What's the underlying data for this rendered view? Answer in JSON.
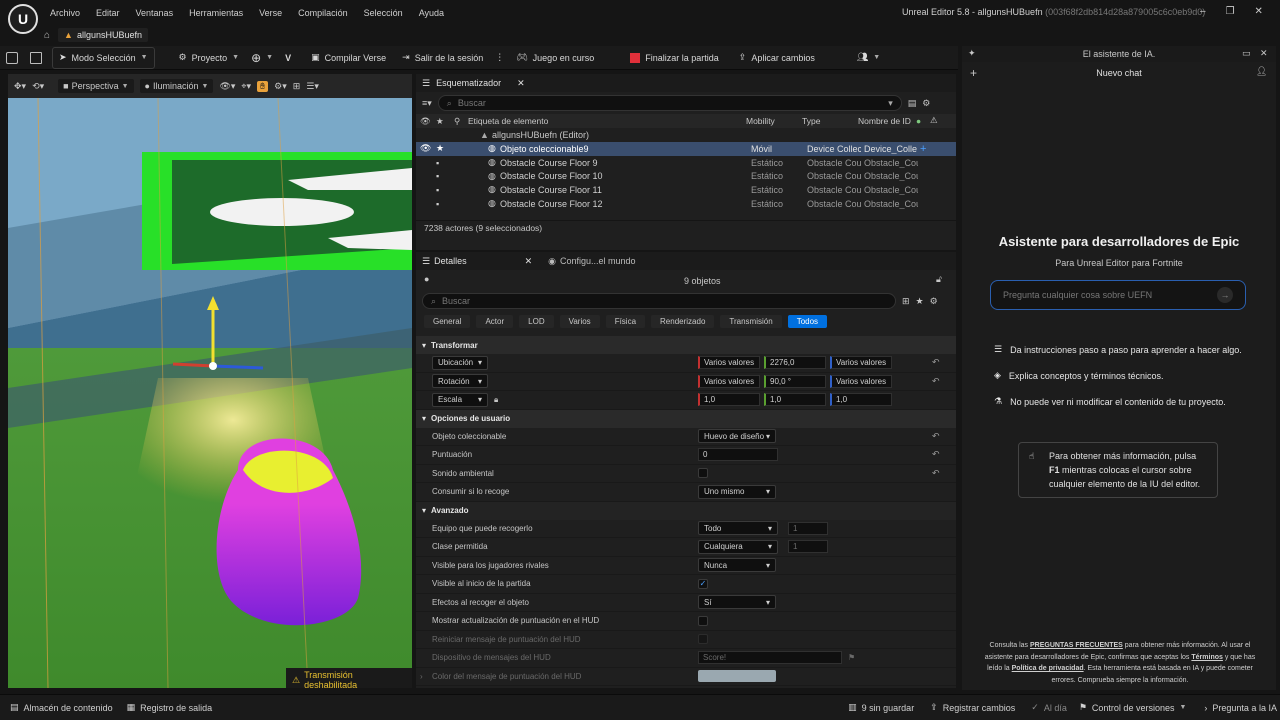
{
  "menu": [
    "Archivo",
    "Editar",
    "Ventanas",
    "Herramientas",
    "Verse",
    "Compilación",
    "Selección",
    "Ayuda"
  ],
  "window_title": "Unreal Editor 5.8 - allgunsHUBuefn",
  "window_id": "(003f68f2db814d28a879005c6c0eb9d0)",
  "project_tab": "allgunsHUBuefn",
  "toolbar": {
    "mode": "Modo Selección",
    "project": "Proyecto",
    "compile_verse": "Compilar Verse",
    "leave_session": "Salir de la sesión",
    "game_in_progress": "Juego en curso",
    "end_game": "Finalizar la partida",
    "apply_changes": "Aplicar cambios"
  },
  "viewport": {
    "perspective": "Perspectiva",
    "lighting": "Iluminación",
    "transmission_disabled": "Transmisión deshabilitada"
  },
  "outliner": {
    "tab_title": "Esquematizador",
    "search_placeholder": "Buscar",
    "columns": {
      "label": "Etiqueta de elemento",
      "mobility": "Mobility",
      "type": "Type",
      "id_name": "Nombre de ID"
    },
    "root": "allgunsHUBuefn (Editor)",
    "rows": [
      {
        "label": "Objeto coleccionable9",
        "mobility": "Móvil",
        "type": "Device Collec",
        "id": "Device_Colle",
        "selected": true
      },
      {
        "label": "Obstacle Course Floor 9",
        "mobility": "Estático",
        "type": "Obstacle Cou",
        "id": "Obstacle_Cou",
        "selected": false
      },
      {
        "label": "Obstacle Course Floor 10",
        "mobility": "Estático",
        "type": "Obstacle Cou",
        "id": "Obstacle_Cou",
        "selected": false
      },
      {
        "label": "Obstacle Course Floor 11",
        "mobility": "Estático",
        "type": "Obstacle Cou",
        "id": "Obstacle_Cou",
        "selected": false
      },
      {
        "label": "Obstacle Course Floor 12",
        "mobility": "Estático",
        "type": "Obstacle Cou",
        "id": "Obstacle_Cou",
        "selected": false
      }
    ],
    "actor_count": "7238 actores (9 seleccionados)"
  },
  "details": {
    "tab_title": "Detalles",
    "world_tab": "Configu...el mundo",
    "objects": "9 objetos",
    "search_placeholder": "Buscar",
    "categories": [
      "General",
      "Actor",
      "LOD",
      "Varios",
      "Física",
      "Renderizado",
      "Transmisión",
      "Todos"
    ],
    "transform": {
      "header": "Transformar",
      "location": "Ubicación",
      "rotation": "Rotación",
      "scale": "Escala",
      "loc_values": [
        "Varios valores",
        "2276,0",
        "Varios valores"
      ],
      "rot_values": [
        "Varios valores",
        "90,0 °",
        "Varios valores"
      ],
      "scale_values": [
        "1,0",
        "1,0",
        "1,0"
      ]
    },
    "user_options": {
      "header": "Opciones de usuario",
      "collectible": "Objeto coleccionable",
      "collectible_val": "Huevo de diseño",
      "score": "Puntuación",
      "score_val": "0",
      "ambient_sound": "Sonido ambiental",
      "consume": "Consumir si lo recoge",
      "consume_val": "Uno mismo"
    },
    "advanced": {
      "header": "Avanzado",
      "team": "Equipo que puede recogerlo",
      "team_val": "Todo",
      "team_num": "1",
      "class": "Clase permitida",
      "class_val": "Cualquiera",
      "class_num": "1",
      "visible_rivals": "Visible para los jugadores rivales",
      "visible_rivals_val": "Nunca",
      "visible_start": "Visible al inicio de la partida",
      "pickup_effects": "Efectos al recoger el objeto",
      "pickup_effects_val": "Sí",
      "show_hud": "Mostrar actualización de puntuación en el HUD",
      "restart_msg": "Reiniciar mensaje de puntuación del HUD",
      "hud_device": "Dispositivo de mensajes del HUD",
      "hud_device_val": "Score!",
      "hud_color": "Color del mensaje de puntuación del HUD"
    }
  },
  "ai": {
    "header": "El asistente de IA.",
    "new_chat": "Nuevo chat",
    "title": "Asistente para desarrolladores de Epic",
    "subtitle": "Para Unreal Editor para Fortnite",
    "placeholder": "Pregunta cualquier cosa sobre UEFN",
    "features": [
      "Da instrucciones paso a paso para aprender a hacer algo.",
      "Explica conceptos y términos técnicos.",
      "No puede ver ni modificar el contenido de tu proyecto."
    ],
    "info_pre": "Para obtener más información, pulsa",
    "info_key": "F1",
    "info_post": "mientras colocas el cursor sobre cualquier elemento de la IU del editor.",
    "footer": {
      "p1": "Consulta las",
      "faq": "PREGUNTAS FRECUENTES",
      "p2": "para obtener más información. Al usar el asistente para desarrolladores de Epic, confirmas que aceptas los",
      "terms": "Términos",
      "p3": "y que has leído la",
      "privacy": "Política de privacidad",
      "p4": ". Esta herramienta está basada en IA y puede cometer errores. Comprueba siempre la información."
    }
  },
  "status": {
    "content": "Almacén de contenido",
    "log": "Registro de salida",
    "unsaved": "9 sin guardar",
    "register_changes": "Registrar cambios",
    "up_to_date": "Al día",
    "version_control": "Control de versiones",
    "ask_ai": "Pregunta a la IA"
  },
  "colors": {
    "accent": "#0070e0",
    "selected_row": "#3a4e6e",
    "end_game_red": "#e0303a"
  }
}
